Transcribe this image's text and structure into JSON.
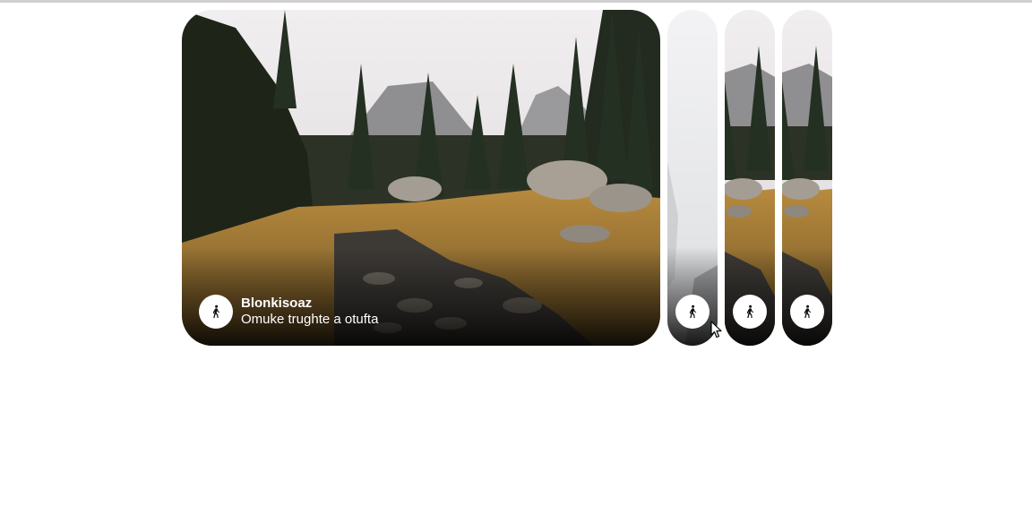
{
  "gallery": {
    "active_card": {
      "title": "Blonkisoaz",
      "subtitle": "Omuke trughte a otufta",
      "icon": "hiking-icon"
    },
    "cards": [
      {
        "icon": "hiking-icon",
        "scene": "forest-stream"
      },
      {
        "icon": "hiking-icon",
        "scene": "foggy-road"
      },
      {
        "icon": "hiking-icon",
        "scene": "forest-stream"
      },
      {
        "icon": "hiking-icon",
        "scene": "forest-stream"
      }
    ]
  },
  "colors": {
    "page_background": "#ffffff",
    "badge_background": "#ffffff",
    "caption_text": "#ffffff",
    "top_rule": "#cfcfcf"
  }
}
